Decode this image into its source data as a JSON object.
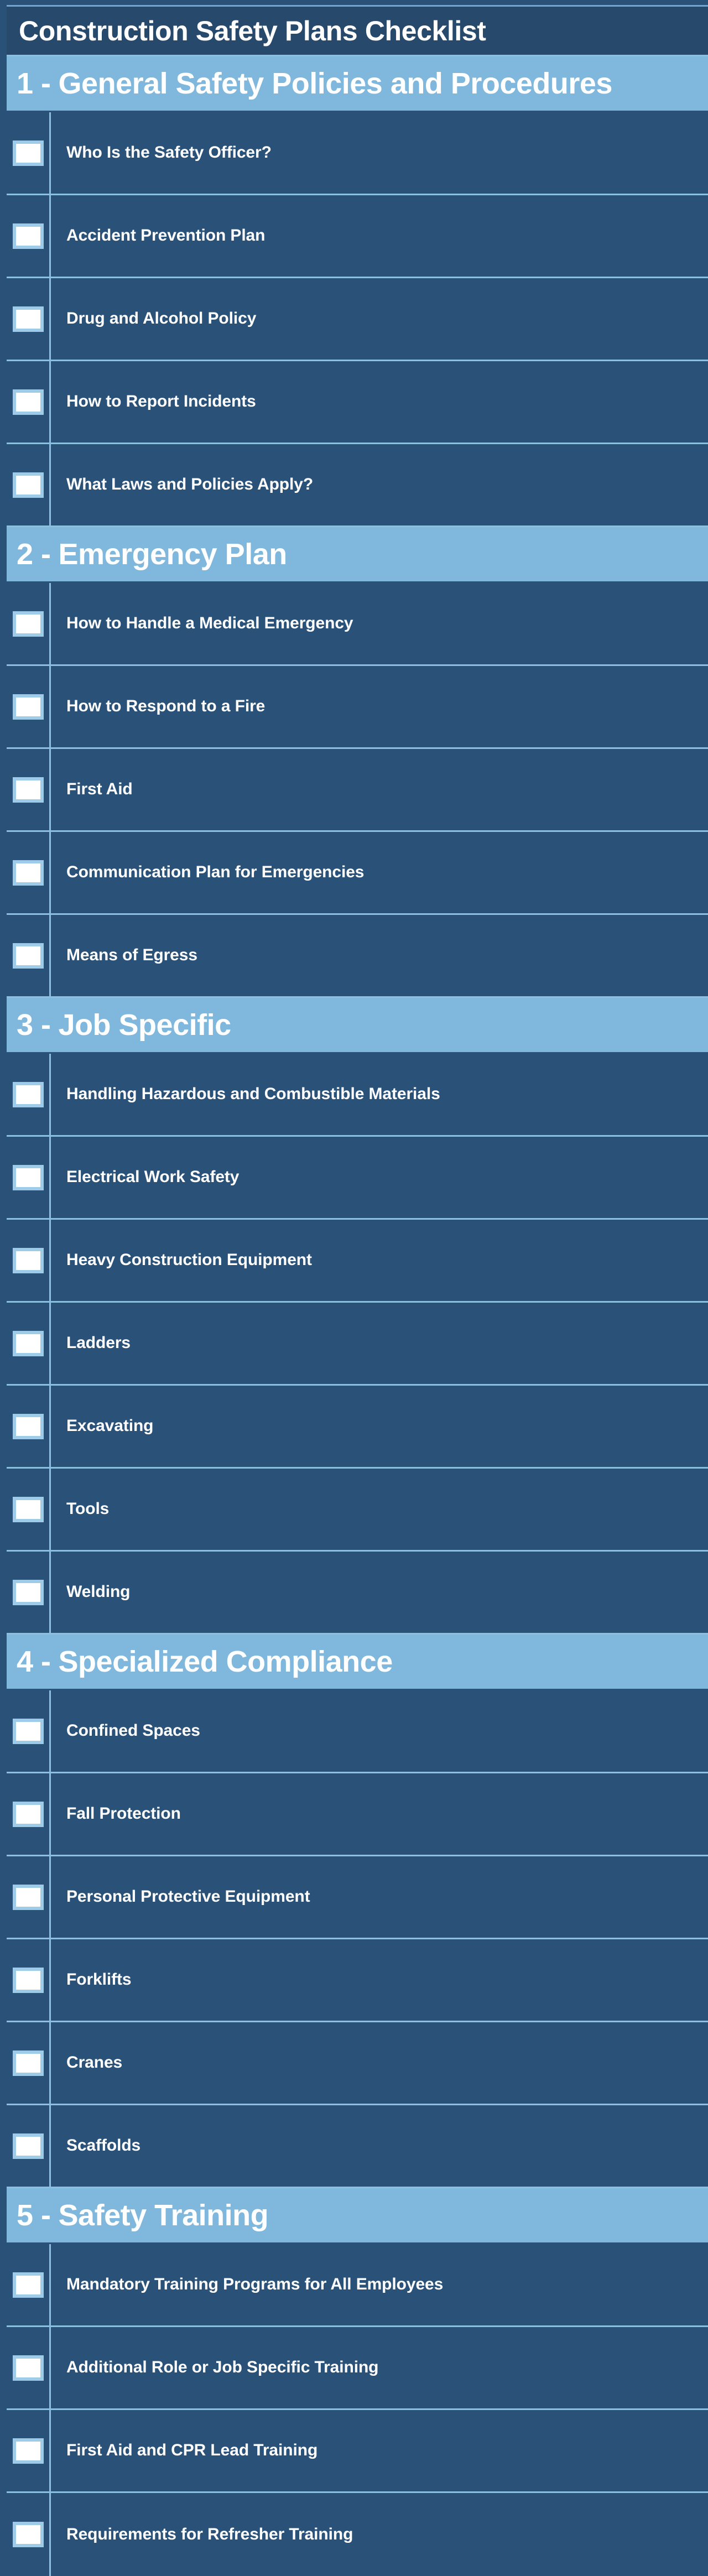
{
  "document": {
    "title": "Construction Safety Plans Checklist"
  },
  "colors": {
    "page_background": "#2a5279",
    "title_bar": "#27496c",
    "section_header": "#7fb8dc",
    "row_background": "#2a5279",
    "grid_line": "#8cc0e0",
    "checkbox_fill": "#ffffff",
    "checkbox_border": "#9ecbe8",
    "text": "#ffffff"
  },
  "checkbox": {
    "icon": "empty-checkbox-icon",
    "checked": false
  },
  "sections": [
    {
      "number": "1 -",
      "label": "General Safety Policies and Procedures",
      "items": [
        {
          "label": "Who Is the Safety Officer?",
          "checked": false
        },
        {
          "label": "Accident Prevention Plan",
          "checked": false
        },
        {
          "label": "Drug and Alcohol Policy",
          "checked": false
        },
        {
          "label": "How to Report Incidents",
          "checked": false
        },
        {
          "label": "What Laws and Policies Apply?",
          "checked": false
        }
      ]
    },
    {
      "number": "2 -",
      "label": "Emergency Plan",
      "items": [
        {
          "label": "How to Handle a Medical Emergency",
          "checked": false
        },
        {
          "label": "How to Respond to a Fire",
          "checked": false
        },
        {
          "label": "First Aid",
          "checked": false
        },
        {
          "label": "Communication Plan for Emergencies",
          "checked": false
        },
        {
          "label": "Means of Egress",
          "checked": false
        }
      ]
    },
    {
      "number": "3 -",
      "label": "Job Specific",
      "items": [
        {
          "label": "Handling Hazardous and Combustible Materials",
          "checked": false
        },
        {
          "label": "Electrical Work Safety",
          "checked": false
        },
        {
          "label": "Heavy Construction Equipment",
          "checked": false
        },
        {
          "label": "Ladders",
          "checked": false
        },
        {
          "label": "Excavating",
          "checked": false
        },
        {
          "label": "Tools",
          "checked": false
        },
        {
          "label": "Welding",
          "checked": false
        }
      ]
    },
    {
      "number": "4 -",
      "label": "Specialized Compliance",
      "items": [
        {
          "label": "Confined Spaces",
          "checked": false
        },
        {
          "label": "Fall Protection",
          "checked": false
        },
        {
          "label": "Personal Protective Equipment",
          "checked": false
        },
        {
          "label": "Forklifts",
          "checked": false
        },
        {
          "label": "Cranes",
          "checked": false
        },
        {
          "label": "Scaffolds",
          "checked": false
        }
      ]
    },
    {
      "number": "5 -",
      "label": "Safety Training",
      "items": [
        {
          "label": "Mandatory Training Programs for All Employees",
          "checked": false
        },
        {
          "label": "Additional Role or Job Specific Training",
          "checked": false
        },
        {
          "label": "First Aid and CPR Lead Training",
          "checked": false
        },
        {
          "label": "Requirements for Refresher Training",
          "checked": false
        }
      ]
    }
  ]
}
